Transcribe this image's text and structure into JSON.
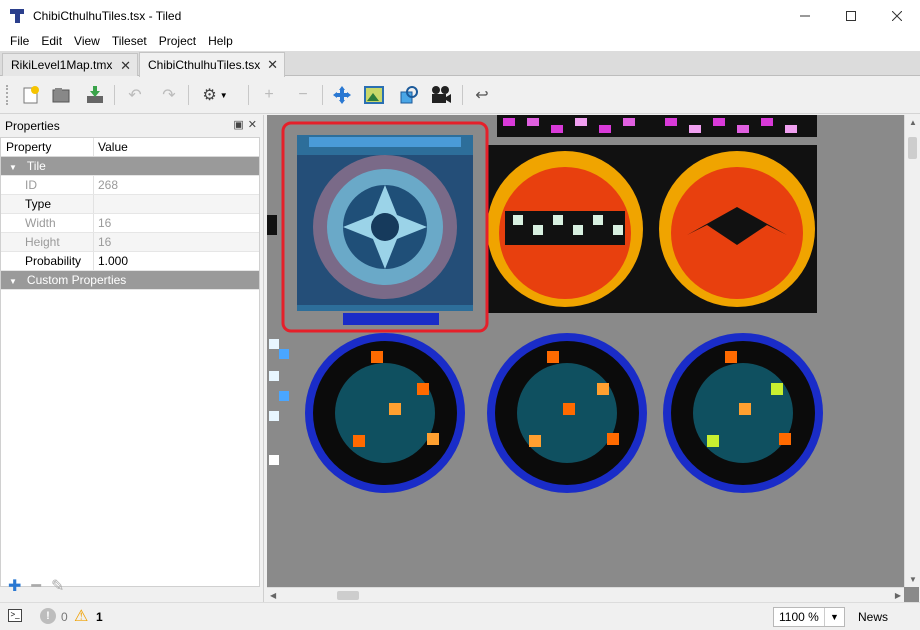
{
  "window": {
    "title": "ChibiCthulhuTiles.tsx - Tiled"
  },
  "menu": [
    {
      "label": "File"
    },
    {
      "label": "Edit"
    },
    {
      "label": "View"
    },
    {
      "label": "Tileset"
    },
    {
      "label": "Project"
    },
    {
      "label": "Help"
    }
  ],
  "tabs": [
    {
      "label": "RikiLevel1Map.tmx",
      "active": false
    },
    {
      "label": "ChibiCthulhuTiles.tsx",
      "active": true
    }
  ],
  "toolbar": {
    "icons": [
      "new-tileset-icon",
      "open-icon",
      "save-icon",
      "undo-icon",
      "redo-icon",
      "settings-icon",
      "add-icon",
      "remove-icon",
      "move-icon",
      "image-icon",
      "shapes-icon",
      "animation-icon",
      "back-icon"
    ]
  },
  "properties": {
    "title": "Properties",
    "columns": {
      "property": "Property",
      "value": "Value"
    },
    "group_tile": "Tile",
    "rows": [
      {
        "name": "ID",
        "value": "268",
        "enabled": false
      },
      {
        "name": "Type",
        "value": "",
        "enabled": true
      },
      {
        "name": "Width",
        "value": "16",
        "enabled": false
      },
      {
        "name": "Height",
        "value": "16",
        "enabled": false
      },
      {
        "name": "Probability",
        "value": "1.000",
        "enabled": true
      }
    ],
    "group_custom": "Custom Properties"
  },
  "status": {
    "errors": "0",
    "warnings": "1",
    "zoom": "1100 %",
    "news": "News"
  },
  "colors": {
    "selection": "#e5202a",
    "canvas": "#8a8a8a",
    "tile_blue": "#1550a0",
    "tile_orange": "#ff6a00",
    "tile_black": "#000000"
  }
}
